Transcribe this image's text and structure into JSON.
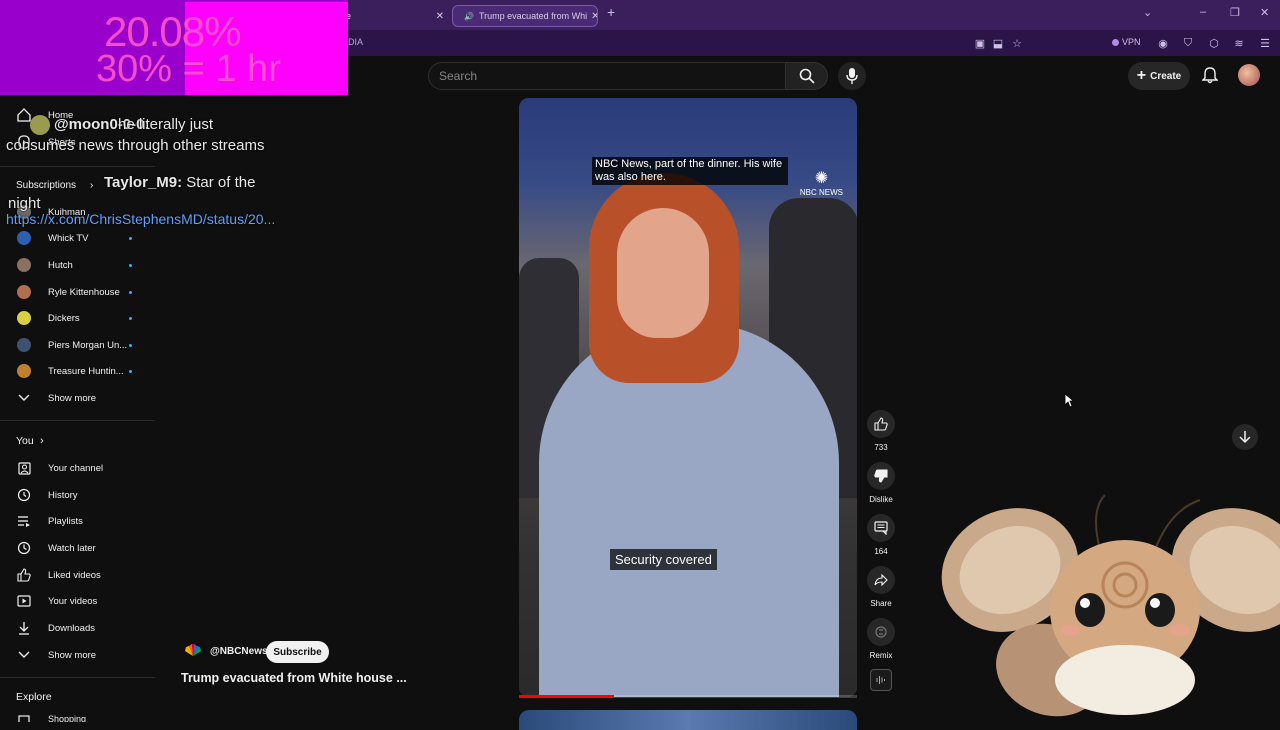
{
  "browser": {
    "tabs": [
      {
        "label": "e",
        "active": false
      },
      {
        "label": "Trump evacuated from Whi",
        "active": true
      }
    ],
    "url_fragment": "DIA",
    "vpn_label": "VPN"
  },
  "overlay": {
    "percent_text": "20.08%",
    "rate_text": "30% = 1 hr",
    "chat": [
      {
        "user": "@moon0-0-0:",
        "message": "he literally just consumes news through other streams"
      },
      {
        "user": "Taylor_M9:",
        "message": "Star of the night"
      },
      {
        "user": "",
        "message": "https://x.com/ChrisStephensMD/status/20..."
      }
    ]
  },
  "topbar": {
    "search_placeholder": "Search",
    "create_label": "Create"
  },
  "sidebar": {
    "top_items": [
      {
        "label": "Home",
        "icon": "home-icon"
      },
      {
        "label": "Shorts",
        "icon": "shorts-icon"
      }
    ],
    "subscriptions_heading": "Subscriptions",
    "subscriptions": [
      {
        "label": "Kuihman",
        "color": "#6a6a6a"
      },
      {
        "label": "Whick TV",
        "color": "#2d5fb0"
      },
      {
        "label": "Hutch",
        "color": "#8a7060"
      },
      {
        "label": "Ryle Kittenhouse",
        "color": "#b07050"
      },
      {
        "label": "Dickers",
        "color": "#d8d040"
      },
      {
        "label": "Piers Morgan Un...",
        "color": "#405070"
      },
      {
        "label": "Treasure Huntin...",
        "color": "#c08030"
      }
    ],
    "show_more_1": "Show more",
    "you_heading": "You",
    "you_items": [
      {
        "label": "Your channel",
        "icon": "channel-icon"
      },
      {
        "label": "History",
        "icon": "history-icon"
      },
      {
        "label": "Playlists",
        "icon": "playlists-icon"
      },
      {
        "label": "Watch later",
        "icon": "clock-icon"
      },
      {
        "label": "Liked videos",
        "icon": "thumbs-up-icon"
      },
      {
        "label": "Your videos",
        "icon": "video-icon"
      },
      {
        "label": "Downloads",
        "icon": "download-icon"
      }
    ],
    "show_more_2": "Show more",
    "explore_heading": "Explore",
    "explore_items": [
      {
        "label": "Shopping",
        "icon": "shopping-icon"
      }
    ]
  },
  "video": {
    "caption_top": "NBC News, part of the dinner. His wife was also here.",
    "caption_bottom": "Security covered",
    "watermark": "NBC NEWS",
    "progress": 0.28
  },
  "actions": {
    "like_count": "733",
    "dislike_label": "Dislike",
    "comment_count": "164",
    "share_label": "Share",
    "remix_label": "Remix"
  },
  "channel": {
    "handle": "@NBCNews",
    "subscribe_label": "Subscribe",
    "video_title": "Trump evacuated from White house ..."
  }
}
